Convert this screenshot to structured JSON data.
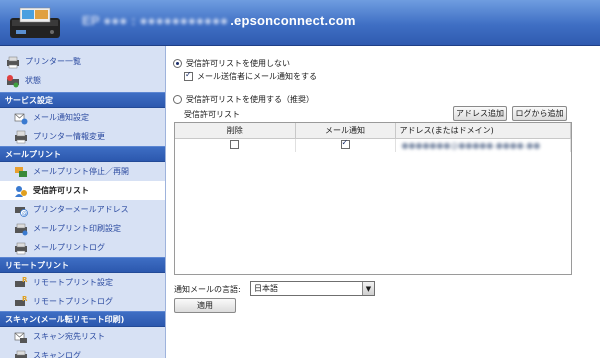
{
  "header": {
    "title_blurred": "EP ●●● : ●●●●●●●●●●●",
    "title_domain": ".epsonconnect.com"
  },
  "sidebar": {
    "items_top": [
      {
        "label": "プリンター一覧",
        "icon": "printer-list-icon"
      },
      {
        "label": "状態",
        "icon": "status-icon"
      }
    ],
    "sections": [
      {
        "title": "サービス設定",
        "items": [
          {
            "label": "メール通知設定",
            "icon": "mail-notify-icon"
          },
          {
            "label": "プリンター情報変更",
            "icon": "printer-info-icon"
          }
        ]
      },
      {
        "title": "メールプリント",
        "items": [
          {
            "label": "メールプリント停止／再開",
            "icon": "email-print-toggle-icon"
          },
          {
            "label": "受信許可リスト",
            "icon": "approved-list-icon",
            "active": true
          },
          {
            "label": "プリンターメールアドレス",
            "icon": "printer-email-icon"
          },
          {
            "label": "メールプリント印刷設定",
            "icon": "email-print-settings-icon"
          },
          {
            "label": "メールプリントログ",
            "icon": "email-print-log-icon"
          }
        ]
      },
      {
        "title": "リモートプリント",
        "items": [
          {
            "label": "リモートプリント設定",
            "icon": "remote-print-settings-icon"
          },
          {
            "label": "リモートプリントログ",
            "icon": "remote-print-log-icon"
          }
        ]
      },
      {
        "title": "スキャン(メール転リモート印刷)",
        "items": [
          {
            "label": "スキャン宛先リスト",
            "icon": "scan-destination-icon"
          },
          {
            "label": "スキャンログ",
            "icon": "scan-log-icon"
          }
        ]
      }
    ]
  },
  "main": {
    "option_not_use": "受信許可リストを使用しない",
    "option_notify_sender": "メール送信者にメール通知をする",
    "option_use": "受信許可リストを使用する（推奨）",
    "list_label": "受信許可リスト",
    "add_address_button": "アドレス追加",
    "add_from_log_button": "ログから追加",
    "table": {
      "columns": [
        "削除",
        "メール通知",
        "アドレス(またはドメイン)"
      ],
      "row": {
        "delete": false,
        "notify": true,
        "address_blurred": "●●●●●●●@●●●●●.●●●●.●●"
      }
    },
    "language_label": "通知メールの言語:",
    "language_value": "日本語",
    "apply_button": "適用"
  },
  "colors": {
    "header": "#3f6fc4",
    "sidebar_bg": "#d7e1f4",
    "section_bg": "#2c58ae",
    "link": "#2b4aa0"
  }
}
